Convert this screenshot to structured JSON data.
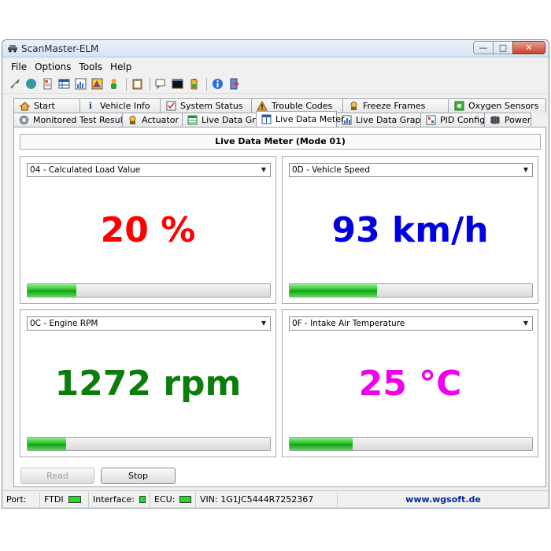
{
  "window": {
    "title": "ScanMaster-ELM",
    "minimize": "—",
    "maximize": "□",
    "close": "✕"
  },
  "menu": [
    "File",
    "Options",
    "Tools",
    "Help"
  ],
  "toolbar_icons": [
    "wrench-icon",
    "globe-icon",
    "document-icon",
    "table-icon",
    "chart-icon",
    "colorful-icon",
    "person-icon",
    "clipboard-icon",
    "chat-icon",
    "terminal-icon",
    "battery-icon",
    "info-icon",
    "exit-icon"
  ],
  "tabs_row1": [
    {
      "label": "Start",
      "icon": "house-icon"
    },
    {
      "label": "Vehicle Info",
      "icon": "info-icon"
    },
    {
      "label": "System Status",
      "icon": "checklist-icon"
    },
    {
      "label": "Trouble Codes",
      "icon": "warning-icon"
    },
    {
      "label": "Freeze Frames",
      "icon": "freeze-icon"
    },
    {
      "label": "Oxygen Sensors",
      "icon": "sensor-icon"
    }
  ],
  "tabs_row2": [
    {
      "label": "Monitored Test Results",
      "icon": "gear-icon"
    },
    {
      "label": "Actuator",
      "icon": "actuator-icon"
    },
    {
      "label": "Live Data Grid",
      "icon": "grid-icon"
    },
    {
      "label": "Live Data Meter",
      "icon": "meter-icon",
      "active": true
    },
    {
      "label": "Live Data Graph",
      "icon": "graph-icon"
    },
    {
      "label": "PID Config",
      "icon": "config-icon"
    },
    {
      "label": "Power",
      "icon": "chip-icon"
    }
  ],
  "section_title": "Live Data Meter (Mode 01)",
  "meters": [
    {
      "pid": "04 - Calculated Load Value",
      "reading": "20 %",
      "color": "#ff0000",
      "level": 0.2
    },
    {
      "pid": "0D - Vehicle Speed",
      "reading": "93 km/h",
      "color": "#0000e0",
      "level": 0.36
    },
    {
      "pid": "0C - Engine RPM",
      "reading": "1272 rpm",
      "color": "#0a7d0a",
      "level": 0.16
    },
    {
      "pid": "0F - Intake Air Temperature",
      "reading": "25 °C",
      "color": "#ee00ee",
      "level": 0.26
    }
  ],
  "buttons": {
    "read": "Read",
    "stop": "Stop"
  },
  "status": {
    "port_label": "Port:",
    "port_value": "FTDI",
    "interface_label": "Interface:",
    "ecu_label": "ECU:",
    "vin": "VIN: 1G1JC5444R7252367",
    "website": "www.wgsoft.de"
  }
}
